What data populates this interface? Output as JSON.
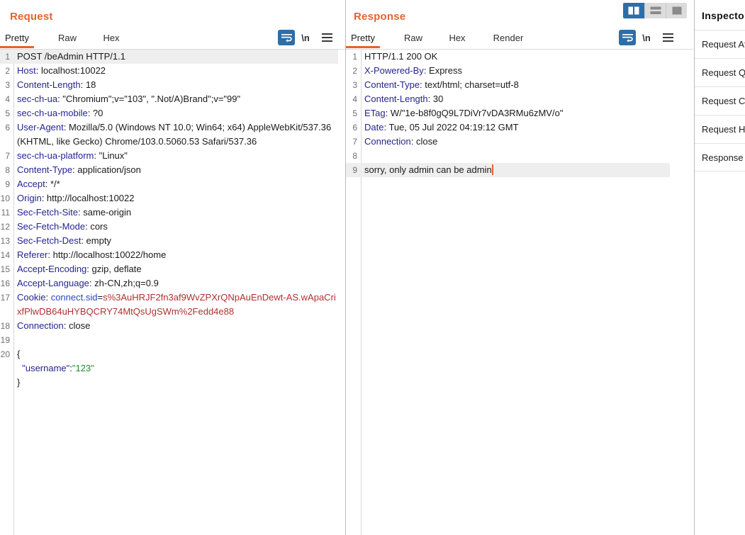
{
  "colors": {
    "accent_orange": "#e8622c",
    "selected_blue": "#2c6ea8",
    "header_name": "#25258f",
    "cookie_value": "#b03030",
    "json_string": "#1f8a2f",
    "row_highlight": "#eeeeee"
  },
  "request": {
    "title": "Request",
    "tabs": [
      {
        "label": "Pretty",
        "active": true
      },
      {
        "label": "Raw",
        "active": false
      },
      {
        "label": "Hex",
        "active": false
      }
    ],
    "tools": [
      {
        "name": "word-wrap-icon",
        "selected": true
      },
      {
        "name": "newline-toggle",
        "label": "\\n",
        "selected": false
      },
      {
        "name": "menu-icon",
        "selected": false
      }
    ],
    "lines": [
      {
        "n": "1",
        "highlight": true,
        "segments": [
          {
            "text": "POST /beAdmin HTTP/1.1",
            "style": "val"
          }
        ]
      },
      {
        "n": "2",
        "highlight": false,
        "segments": [
          {
            "text": "Host",
            "style": "hdr"
          },
          {
            "text": ": localhost:10022",
            "style": "val"
          }
        ]
      },
      {
        "n": "3",
        "highlight": false,
        "segments": [
          {
            "text": "Content-Length",
            "style": "hdr"
          },
          {
            "text": ": 18",
            "style": "val"
          }
        ]
      },
      {
        "n": "4",
        "highlight": false,
        "segments": [
          {
            "text": "sec-ch-ua",
            "style": "hdr"
          },
          {
            "text": ": \"Chromium\";v=\"103\", \".Not/A)Brand\";v=\"99\"",
            "style": "val"
          }
        ]
      },
      {
        "n": "5",
        "highlight": false,
        "segments": [
          {
            "text": "sec-ch-ua-mobile",
            "style": "hdr"
          },
          {
            "text": ": ?0",
            "style": "val"
          }
        ]
      },
      {
        "n": "6",
        "highlight": false,
        "segments": [
          {
            "text": "User-Agent",
            "style": "hdr"
          },
          {
            "text": ": Mozilla/5.0 (Windows NT 10.0; Win64; x64) AppleWebKit/537.36 (KHTML, like Gecko) Chrome/103.0.5060.53 Safari/537.36",
            "style": "val"
          }
        ]
      },
      {
        "n": "7",
        "highlight": false,
        "segments": [
          {
            "text": "sec-ch-ua-platform",
            "style": "hdr"
          },
          {
            "text": ": \"Linux\"",
            "style": "val"
          }
        ]
      },
      {
        "n": "8",
        "highlight": false,
        "segments": [
          {
            "text": "Content-Type",
            "style": "hdr"
          },
          {
            "text": ": application/json",
            "style": "val"
          }
        ]
      },
      {
        "n": "9",
        "highlight": false,
        "segments": [
          {
            "text": "Accept",
            "style": "hdr"
          },
          {
            "text": ": */*",
            "style": "val"
          }
        ]
      },
      {
        "n": "10",
        "highlight": false,
        "segments": [
          {
            "text": "Origin",
            "style": "hdr"
          },
          {
            "text": ": http://localhost:10022",
            "style": "val"
          }
        ]
      },
      {
        "n": "11",
        "highlight": false,
        "segments": [
          {
            "text": "Sec-Fetch-Site",
            "style": "hdr"
          },
          {
            "text": ": same-origin",
            "style": "val"
          }
        ]
      },
      {
        "n": "12",
        "highlight": false,
        "segments": [
          {
            "text": "Sec-Fetch-Mode",
            "style": "hdr"
          },
          {
            "text": ": cors",
            "style": "val"
          }
        ]
      },
      {
        "n": "13",
        "highlight": false,
        "segments": [
          {
            "text": "Sec-Fetch-Dest",
            "style": "hdr"
          },
          {
            "text": ": empty",
            "style": "val"
          }
        ]
      },
      {
        "n": "14",
        "highlight": false,
        "segments": [
          {
            "text": "Referer",
            "style": "hdr"
          },
          {
            "text": ": http://localhost:10022/home",
            "style": "val"
          }
        ]
      },
      {
        "n": "15",
        "highlight": false,
        "segments": [
          {
            "text": "Accept-Encoding",
            "style": "hdr"
          },
          {
            "text": ": gzip, deflate",
            "style": "val"
          }
        ]
      },
      {
        "n": "16",
        "highlight": false,
        "segments": [
          {
            "text": "Accept-Language",
            "style": "hdr"
          },
          {
            "text": ": zh-CN,zh;q=0.9",
            "style": "val"
          }
        ]
      },
      {
        "n": "17",
        "highlight": false,
        "segments": [
          {
            "text": "Cookie",
            "style": "hdr"
          },
          {
            "text": ": ",
            "style": "val"
          },
          {
            "text": "connect.sid",
            "style": "ckey"
          },
          {
            "text": "=",
            "style": "val"
          },
          {
            "text": "s%3AuHRJF2fn3af9WvZPXrQNpAuEnDewt-AS.wApaCrixfPlwDB64uHYBQCRY74MtQsUgSWm%2Fedd4e88",
            "style": "cval"
          }
        ]
      },
      {
        "n": "18",
        "highlight": false,
        "segments": [
          {
            "text": "Connection",
            "style": "hdr"
          },
          {
            "text": ": close",
            "style": "val"
          }
        ]
      },
      {
        "n": "19",
        "highlight": false,
        "segments": [
          {
            "text": "",
            "style": "val"
          }
        ]
      },
      {
        "n": "20",
        "highlight": false,
        "segments": [
          {
            "text": "{",
            "style": "val"
          }
        ]
      },
      {
        "n": "",
        "highlight": false,
        "segments": [
          {
            "text": "  ",
            "style": "val"
          },
          {
            "text": "\"username\"",
            "style": "jkey"
          },
          {
            "text": ":",
            "style": "val"
          },
          {
            "text": "\"123\"",
            "style": "jstr"
          }
        ]
      },
      {
        "n": "",
        "highlight": false,
        "segments": [
          {
            "text": "}",
            "style": "val"
          }
        ]
      }
    ]
  },
  "response": {
    "title": "Response",
    "tabs": [
      {
        "label": "Pretty",
        "active": true
      },
      {
        "label": "Raw",
        "active": false
      },
      {
        "label": "Hex",
        "active": false
      },
      {
        "label": "Render",
        "active": false
      }
    ],
    "tools": [
      {
        "name": "word-wrap-icon",
        "selected": true
      },
      {
        "name": "newline-toggle",
        "label": "\\n",
        "selected": false
      },
      {
        "name": "menu-icon",
        "selected": false
      }
    ],
    "lines": [
      {
        "n": "1",
        "highlight": false,
        "segments": [
          {
            "text": "HTTP/1.1 200 OK",
            "style": "val"
          }
        ]
      },
      {
        "n": "2",
        "highlight": false,
        "segments": [
          {
            "text": "X-Powered-By",
            "style": "hdr"
          },
          {
            "text": ": Express",
            "style": "val"
          }
        ]
      },
      {
        "n": "3",
        "highlight": false,
        "segments": [
          {
            "text": "Content-Type",
            "style": "hdr"
          },
          {
            "text": ": text/html; charset=utf-8",
            "style": "val"
          }
        ]
      },
      {
        "n": "4",
        "highlight": false,
        "segments": [
          {
            "text": "Content-Length",
            "style": "hdr"
          },
          {
            "text": ": 30",
            "style": "val"
          }
        ]
      },
      {
        "n": "5",
        "highlight": false,
        "segments": [
          {
            "text": "ETag",
            "style": "hdr"
          },
          {
            "text": ": W/\"1e-b8f0gQ9L7DiVr7vDA3RMu6zMV/o\"",
            "style": "val"
          }
        ]
      },
      {
        "n": "6",
        "highlight": false,
        "segments": [
          {
            "text": "Date",
            "style": "hdr"
          },
          {
            "text": ": Tue, 05 Jul 2022 04:19:12 GMT",
            "style": "val"
          }
        ]
      },
      {
        "n": "7",
        "highlight": false,
        "segments": [
          {
            "text": "Connection",
            "style": "hdr"
          },
          {
            "text": ": close",
            "style": "val"
          }
        ]
      },
      {
        "n": "8",
        "highlight": false,
        "segments": [
          {
            "text": "",
            "style": "val"
          }
        ]
      },
      {
        "n": "9",
        "highlight": true,
        "caret": true,
        "segments": [
          {
            "text": "sorry, only admin can be admin",
            "style": "val"
          }
        ]
      }
    ]
  },
  "layout_toggle": [
    {
      "name": "layout-side-by-side",
      "selected": true
    },
    {
      "name": "layout-stacked",
      "selected": false
    },
    {
      "name": "layout-single",
      "selected": false
    }
  ],
  "inspector": {
    "title": "Inspector",
    "rows": [
      {
        "label": "Request Attributes"
      },
      {
        "label": "Request Query Parameters"
      },
      {
        "label": "Request Cookies"
      },
      {
        "label": "Request Headers"
      },
      {
        "label": "Response Headers"
      }
    ]
  }
}
